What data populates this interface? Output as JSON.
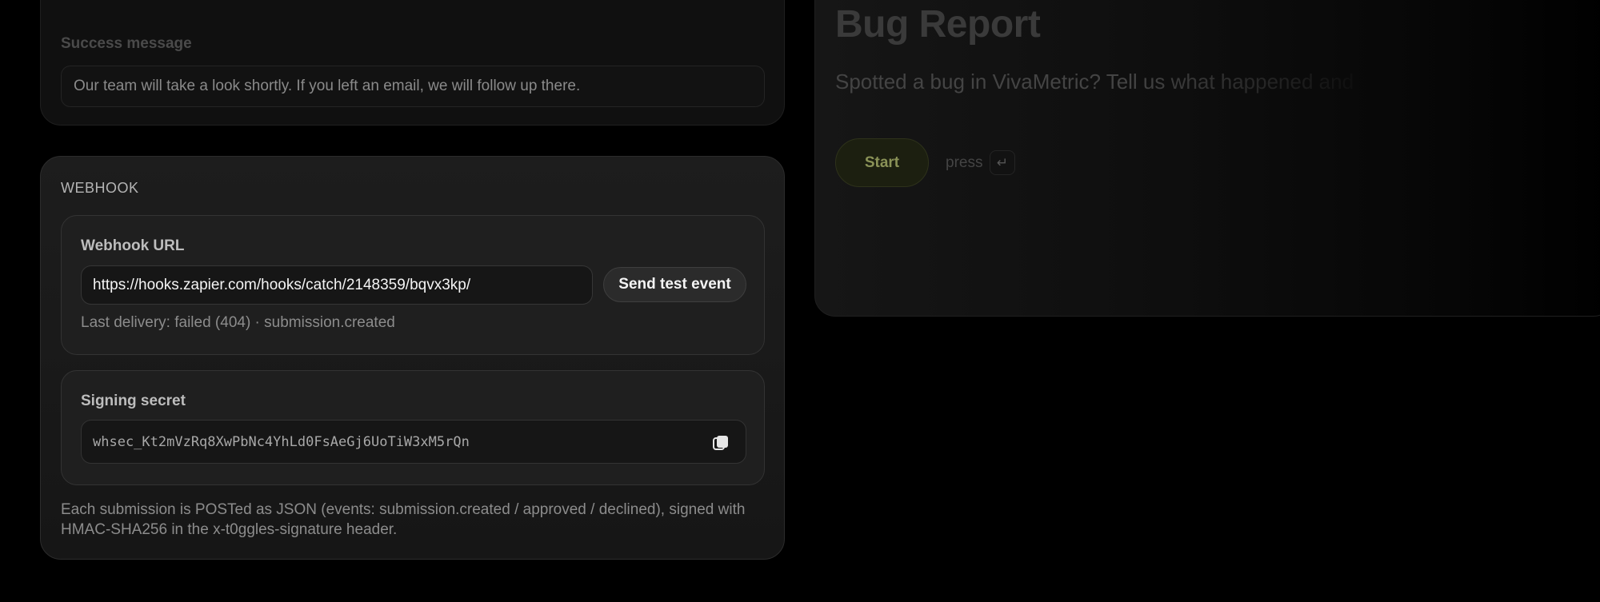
{
  "success": {
    "label": "Success message",
    "value": "Our team will take a look shortly. If you left an email, we will follow up there."
  },
  "webhook": {
    "section_title": "WEBHOOK",
    "url_label": "Webhook URL",
    "url_value": "https://hooks.zapier.com/hooks/catch/2148359/bqvx3kp/",
    "test_button": "Send test event",
    "last_delivery": "Last delivery: failed (404) · submission.created",
    "secret_label": "Signing secret",
    "secret_value": "whsec_Kt2mVzRq8XwPbNc4YhLd0FsAeGj6UoTiW3xM5rQn",
    "copy_icon": "copy-icon",
    "footnote": "Each submission is POSTed as JSON (events: submission.created / approved / declined), signed with HMAC-SHA256 in the x-t0ggles-signature header."
  },
  "preview": {
    "title": "Bug Report",
    "subtitle": "Spotted a bug in VivaMetric? Tell us what happened and",
    "start_button": "Start",
    "press_label": "press",
    "enter_key": "↵",
    "accent_color": "#8a9257"
  }
}
